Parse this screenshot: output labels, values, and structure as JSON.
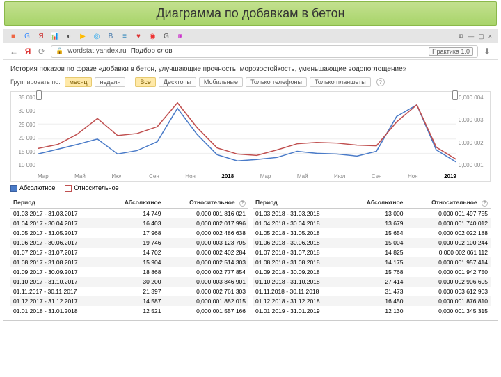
{
  "slide_title": "Диаграмма по добавкам в бетон",
  "url": {
    "host": "wordstat.yandex.ru",
    "page": "Подбор слов",
    "badge": "Практика 1.0"
  },
  "query": "История показов по фразе «добавки в бетон, улучшающие прочность, морозостойкость, уменьшающие водопоглощение»",
  "group_label": "Группировать по:",
  "group_tabs": [
    "месяц",
    "неделя"
  ],
  "device_tabs": [
    "Все",
    "Десктопы",
    "Мобильные",
    "Только телефоны",
    "Только планшеты"
  ],
  "legend": {
    "abs": "Абсолютное",
    "rel": "Относительное"
  },
  "chart_data": {
    "type": "line",
    "x_labels": [
      "Мар",
      "Май",
      "Июл",
      "Сен",
      "Ноя",
      "2018",
      "Мар",
      "Май",
      "Июл",
      "Сен",
      "Ноя",
      "2019"
    ],
    "y_left_ticks": [
      "35 000",
      "30 000",
      "25 000",
      "20 000",
      "15 000",
      "10 000"
    ],
    "y_right_ticks": [
      "0,000 004",
      "0,000 003",
      "0,000 002",
      "0,000 001"
    ],
    "series": [
      {
        "name": "Абсолютное",
        "values": [
          14749,
          16403,
          17968,
          19746,
          14702,
          15904,
          18868,
          30200,
          21397,
          14587,
          12521,
          13000,
          13679,
          15654,
          15004,
          14825,
          14175,
          15768,
          27414,
          31473,
          16450,
          12130
        ]
      },
      {
        "name": "Относительное",
        "values": [
          1.816e-06,
          2.018e-06,
          2.487e-06,
          3.124e-06,
          2.402e-06,
          2.514e-06,
          2.778e-06,
          3.847e-06,
          2.761e-06,
          1.882e-06,
          1.557e-06,
          1.498e-06,
          1.74e-06,
          2.022e-06,
          2.1e-06,
          2.061e-06,
          1.957e-06,
          1.943e-06,
          2.906e-06,
          3.613e-06,
          1.877e-06,
          1.345e-06
        ]
      }
    ]
  },
  "table_headers": {
    "period": "Период",
    "abs": "Абсолютное",
    "rel": "Относительное"
  },
  "table_left": [
    {
      "p": "01.03.2017 - 31.03.2017",
      "a": "14 749",
      "r": "0,000 001 816 021"
    },
    {
      "p": "01.04.2017 - 30.04.2017",
      "a": "16 403",
      "r": "0,000 002 017 996"
    },
    {
      "p": "01.05.2017 - 31.05.2017",
      "a": "17 968",
      "r": "0,000 002 486 638"
    },
    {
      "p": "01.06.2017 - 30.06.2017",
      "a": "19 746",
      "r": "0,000 003 123 705"
    },
    {
      "p": "01.07.2017 - 31.07.2017",
      "a": "14 702",
      "r": "0,000 002 402 284"
    },
    {
      "p": "01.08.2017 - 31.08.2017",
      "a": "15 904",
      "r": "0,000 002 514 303"
    },
    {
      "p": "01.09.2017 - 30.09.2017",
      "a": "18 868",
      "r": "0,000 002 777 854"
    },
    {
      "p": "01.10.2017 - 31.10.2017",
      "a": "30 200",
      "r": "0,000 003 846 901"
    },
    {
      "p": "01.11.2017 - 30.11.2017",
      "a": "21 397",
      "r": "0,000 002 761 303"
    },
    {
      "p": "01.12.2017 - 31.12.2017",
      "a": "14 587",
      "r": "0,000 001 882 015"
    },
    {
      "p": "01.01.2018 - 31.01.2018",
      "a": "12 521",
      "r": "0,000 001 557 166"
    }
  ],
  "table_right": [
    {
      "p": "01.03.2018 - 31.03.2018",
      "a": "13 000",
      "r": "0,000 001 497 755"
    },
    {
      "p": "01.04.2018 - 30.04.2018",
      "a": "13 679",
      "r": "0,000 001 740 012"
    },
    {
      "p": "01.05.2018 - 31.05.2018",
      "a": "15 654",
      "r": "0,000 002 022 188"
    },
    {
      "p": "01.06.2018 - 30.06.2018",
      "a": "15 004",
      "r": "0,000 002 100 244"
    },
    {
      "p": "01.07.2018 - 31.07.2018",
      "a": "14 825",
      "r": "0,000 002 061 112"
    },
    {
      "p": "01.08.2018 - 31.08.2018",
      "a": "14 175",
      "r": "0,000 001 957 414"
    },
    {
      "p": "01.09.2018 - 30.09.2018",
      "a": "15 768",
      "r": "0,000 001 942 750"
    },
    {
      "p": "01.10.2018 - 31.10.2018",
      "a": "27 414",
      "r": "0,000 002 906 605"
    },
    {
      "p": "01.11.2018 - 30.11.2018",
      "a": "31 473",
      "r": "0,000 003 612 903"
    },
    {
      "p": "01.12.2018 - 31.12.2018",
      "a": "16 450",
      "r": "0,000 001 876 810"
    },
    {
      "p": "01.01.2019 - 31.01.2019",
      "a": "12 130",
      "r": "0,000 001 345 315"
    }
  ]
}
